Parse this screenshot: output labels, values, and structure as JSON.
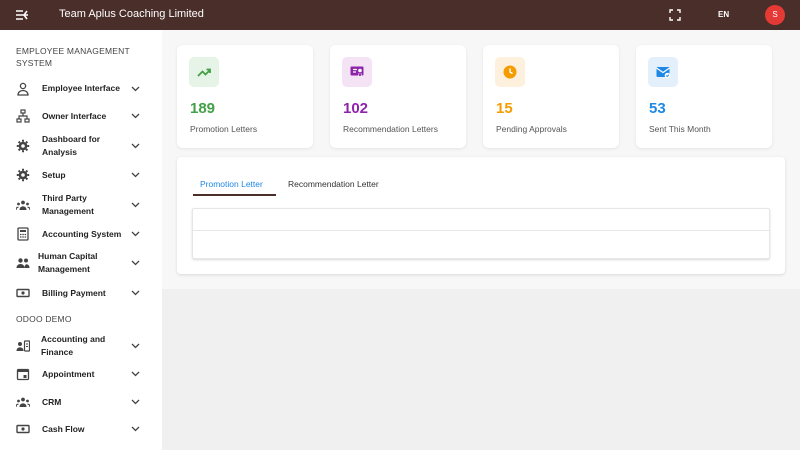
{
  "header": {
    "title": "Team Aplus Coaching Limited",
    "language": "EN",
    "avatar_initial": "S",
    "bg_color": "#4a2e2a",
    "avatar_color": "#e53935"
  },
  "sidebar": {
    "section1_title": "EMPLOYEE MANAGEMENT SYSTEM",
    "section2_title": "ODOO DEMO",
    "items": [
      {
        "label": "Employee Interface",
        "icon": "person-icon"
      },
      {
        "label": "Owner Interface",
        "icon": "sitemap-icon"
      },
      {
        "label": "Dashboard for Analysis",
        "icon": "gear-icon"
      },
      {
        "label": "Setup",
        "icon": "gear-icon"
      },
      {
        "label": "Third Party Management",
        "icon": "group-icon"
      },
      {
        "label": "Accounting System",
        "icon": "calculator-icon"
      },
      {
        "label": "Human Capital Management",
        "icon": "people-icon"
      },
      {
        "label": "Billing Payment",
        "icon": "money-icon"
      },
      {
        "label": "Accounting and Finance",
        "icon": "contacts-icon"
      },
      {
        "label": "Appointment",
        "icon": "calendar-icon"
      },
      {
        "label": "CRM",
        "icon": "group-icon"
      },
      {
        "label": "Cash Flow",
        "icon": "money-icon"
      }
    ]
  },
  "stats": [
    {
      "value": "189",
      "label": "Promotion Letters",
      "color": "#43a047",
      "bg": "#e6f4e7",
      "icon": "trending-up-icon"
    },
    {
      "value": "102",
      "label": "Recommendation Letters",
      "color": "#8e24aa",
      "bg": "#f3e3f5",
      "icon": "recommendation-icon"
    },
    {
      "value": "15",
      "label": "Pending Approvals",
      "color": "#f59c00",
      "bg": "#fdf0dd",
      "icon": "clock-icon"
    },
    {
      "value": "53",
      "label": "Sent This Month",
      "color": "#1e88e5",
      "bg": "#e3f0fc",
      "icon": "mail-sent-icon"
    }
  ],
  "tabs": [
    {
      "label": "Promotion Letter",
      "active": true
    },
    {
      "label": "Recommendation Letter",
      "active": false
    }
  ]
}
